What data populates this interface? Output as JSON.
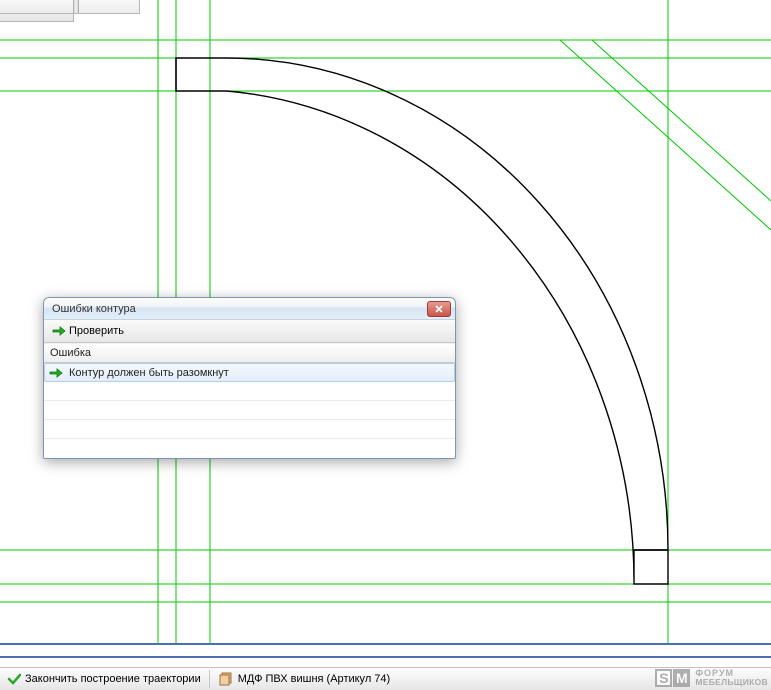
{
  "colors": {
    "guide_green": "#00c800",
    "contour_black": "#000000",
    "ruler_blue": "#4a6fb0"
  },
  "dialog": {
    "title": "Ошибки контура",
    "toolbar": {
      "check_label": "Проверить"
    },
    "column_header": "Ошибка",
    "rows": [
      {
        "text": "Контур должен быть разомкнут"
      }
    ]
  },
  "status": {
    "finish_label": "Закончить построение траектории",
    "material_label": "МДФ ПВХ вишня (Артикул 74)"
  },
  "watermark": {
    "line1": "ФОРУМ",
    "line2": "МЕБЕЛЬЩИКОВ"
  }
}
